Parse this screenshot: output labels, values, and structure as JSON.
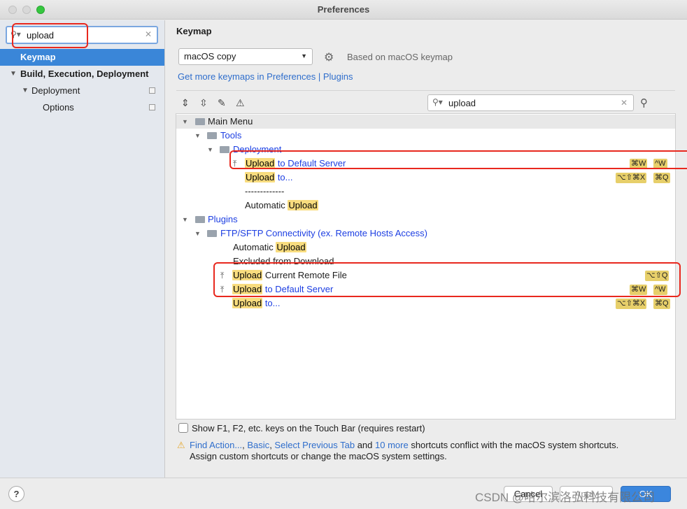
{
  "window": {
    "title": "Preferences"
  },
  "sidebar": {
    "search_value": "upload",
    "items": [
      {
        "label": "Keymap"
      },
      {
        "label": "Build, Execution, Deployment"
      },
      {
        "label": "Deployment"
      },
      {
        "label": "Options"
      }
    ]
  },
  "content": {
    "heading": "Keymap",
    "keymap_select": "macOS copy",
    "based_on": "Based on macOS keymap",
    "more_keymaps_link": "Get more keymaps in Preferences | Plugins",
    "filter_value": "upload"
  },
  "tree": {
    "main_menu": "Main Menu",
    "tools": "Tools",
    "deployment": "Deployment",
    "upload_word": "Upload",
    "to_default_server": " to Default Server",
    "to_ellipsis": " to...",
    "separator": "-------------",
    "automatic": "Automatic ",
    "plugins": "Plugins",
    "ftp": "FTP/SFTP Connectivity (ex. Remote Hosts Access)",
    "excluded": "Excluded from Download",
    "current_remote_file": " Current Remote File",
    "shortcuts": {
      "cmd_w": "⌘W",
      "ctrl_w": "^W",
      "opt_shift_cmd_x": "⌥⇧⌘X",
      "cmd_q": "⌘Q",
      "opt_shift_q": "⌥⇧Q"
    }
  },
  "footer": {
    "touchbar_label": "Show F1, F2, etc. keys on the Touch Bar (requires restart)",
    "conflict": {
      "link_find_action": "Find Action...",
      "comma1": ", ",
      "link_basic": "Basic",
      "comma2": ", ",
      "link_select_prev": "Select Previous Tab",
      "and": " and ",
      "link_more": "10 more",
      "rest": " shortcuts conflict with the macOS system shortcuts.",
      "line2": "Assign custom shortcuts or change the macOS system settings."
    }
  },
  "buttons": {
    "help": "?",
    "cancel": "Cancel",
    "apply": "Apply",
    "ok": "OK"
  },
  "watermark": "CSDN @哈尔滨洛弘科技有限公司",
  "colors": {
    "accent": "#3a86d8",
    "highlight": "#f8dc7e",
    "annotation": "#e8281e"
  }
}
